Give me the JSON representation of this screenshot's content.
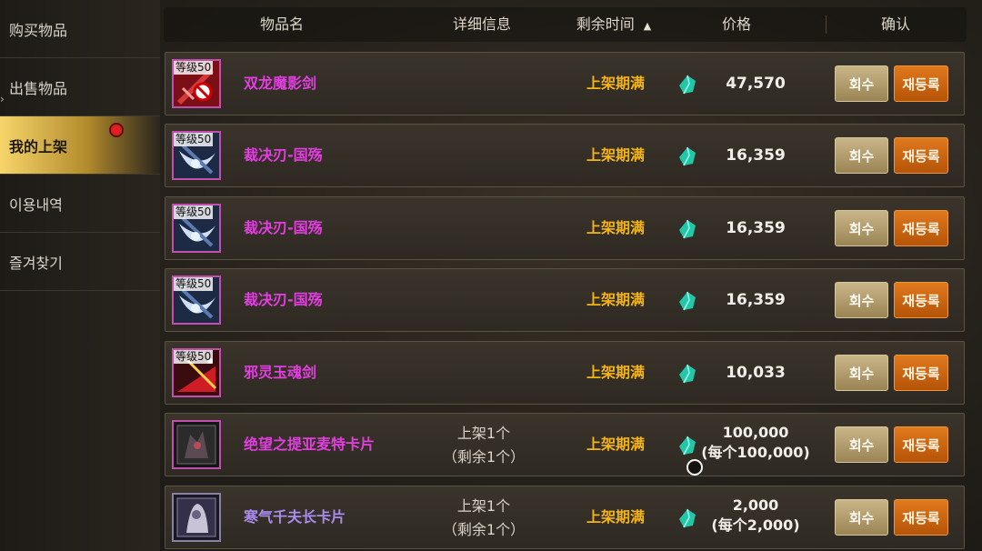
{
  "sidebar": {
    "items": [
      {
        "label": "购买物品"
      },
      {
        "label": "出售物品"
      },
      {
        "label": "我的上架"
      },
      {
        "label": "이용내역"
      },
      {
        "label": "즐겨찾기"
      }
    ],
    "active_index": 2,
    "notification_color": "#e02020"
  },
  "header": {
    "col_name": "物品名",
    "col_detail": "详细信息",
    "col_remaining": "剩余时间",
    "col_remaining_sort": "▲",
    "col_price": "价格",
    "col_confirm": "确认"
  },
  "rows": [
    {
      "level": "等级50",
      "icon": "twin-dragon-sword-icon",
      "name": "双龙魔影剑",
      "name_color": "#e23ee0",
      "detail": [
        "",
        ""
      ],
      "remaining": "上架期满",
      "price": "47,570",
      "price_sub": "",
      "recall_label": "회수",
      "relist_label": "재등록"
    },
    {
      "level": "等级50",
      "icon": "blade-icon",
      "name": "裁决刃-国殇",
      "name_color": "#e23ee0",
      "detail": [
        "",
        ""
      ],
      "remaining": "上架期满",
      "price": "16,359",
      "price_sub": "",
      "recall_label": "회수",
      "relist_label": "재등록"
    },
    {
      "level": "等级50",
      "icon": "blade-icon",
      "name": "裁决刃-国殇",
      "name_color": "#e23ee0",
      "detail": [
        "",
        ""
      ],
      "remaining": "上架期满",
      "price": "16,359",
      "price_sub": "",
      "recall_label": "회수",
      "relist_label": "재등록"
    },
    {
      "level": "等级50",
      "icon": "blade-icon",
      "name": "裁决刃-国殇",
      "name_color": "#e23ee0",
      "detail": [
        "",
        ""
      ],
      "remaining": "上架期满",
      "price": "16,359",
      "price_sub": "",
      "recall_label": "회수",
      "relist_label": "재등록"
    },
    {
      "level": "等级50",
      "icon": "evil-jade-sword-icon",
      "name": "邪灵玉魂剑",
      "name_color": "#e23ee0",
      "detail": [
        "",
        ""
      ],
      "remaining": "上架期满",
      "price": "10,033",
      "price_sub": "",
      "recall_label": "회수",
      "relist_label": "재등록"
    },
    {
      "level": "",
      "icon": "monster-card-icon",
      "name": "绝望之提亚麦特卡片",
      "name_color": "#e23ee0",
      "detail": [
        "上架1个",
        "（剩余1个）"
      ],
      "remaining": "上架期满",
      "price": "100,000",
      "price_sub": "(每个100,000)",
      "recall_label": "회수",
      "relist_label": "재등록"
    },
    {
      "level": "",
      "icon": "monster-card-icon",
      "name": "寒气千夫长卡片",
      "name_color": "#a98cf0",
      "detail": [
        "上架1个",
        "（剩余1个）"
      ],
      "remaining": "上架期满",
      "price": "2,000",
      "price_sub": "(每个2,000)",
      "recall_label": "회수",
      "relist_label": "재등록"
    }
  ],
  "currency_icon": "gem-icon",
  "colors": {
    "remaining_text": "#f4b418",
    "relist_button": "#e07a1e",
    "recall_button": "#c9b688"
  }
}
